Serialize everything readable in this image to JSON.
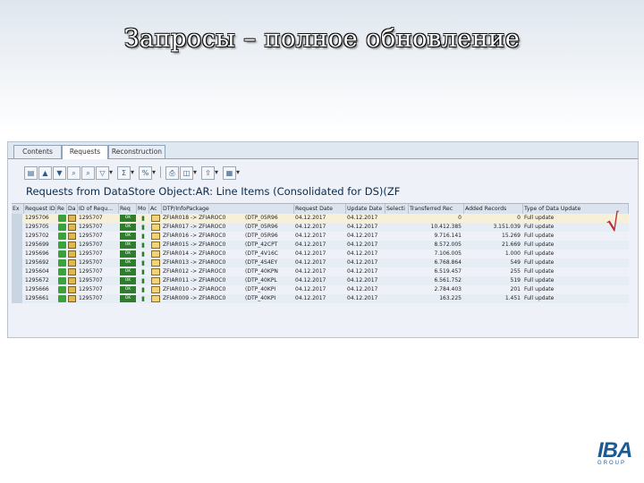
{
  "slide": {
    "title": "Запросы – полное обновление"
  },
  "tabs": [
    "Contents",
    "Requests",
    "Reconstruction"
  ],
  "grid": {
    "title": "Requests from DataStore Object:AR: Line Items (Consolidated for DS)(ZF",
    "columns": [
      "Request ID",
      "Re",
      "Da",
      "ID of Requ...",
      "Req",
      "Mo",
      "Ac",
      "DTP/InfoPackage",
      "Request Date",
      "Update Date",
      "Selecti",
      "Transferred Rec",
      "Added Records",
      "Type of Data Update"
    ],
    "rows": [
      {
        "request_id": "1295706",
        "id_of_request": "1295707",
        "dtp": "ZFIAR018 -> ZFIAROC0",
        "dtp_id": "(DTP_05R96",
        "request_date": "04.12.2017",
        "update_date": "04.12.2017",
        "transferred": "0",
        "added": "0",
        "type": "Full update"
      },
      {
        "request_id": "1295705",
        "id_of_request": "1295707",
        "dtp": "ZFIAR017 -> ZFIAROC0",
        "dtp_id": "(DTP_05R96",
        "request_date": "04.12.2017",
        "update_date": "04.12.2017",
        "transferred": "10.412.385",
        "added": "3.151.039",
        "type": "Full update"
      },
      {
        "request_id": "1295702",
        "id_of_request": "1295707",
        "dtp": "ZFIAR016 -> ZFIAROC0",
        "dtp_id": "(DTP_05R96",
        "request_date": "04.12.2017",
        "update_date": "04.12.2017",
        "transferred": "9.716.141",
        "added": "15.269",
        "type": "Full update"
      },
      {
        "request_id": "1295699",
        "id_of_request": "1295707",
        "dtp": "ZFIAR015 -> ZFIAROC0",
        "dtp_id": "(DTP_42CPT",
        "request_date": "04.12.2017",
        "update_date": "04.12.2017",
        "transferred": "8.572.005",
        "added": "21.669",
        "type": "Full update"
      },
      {
        "request_id": "1295696",
        "id_of_request": "1295707",
        "dtp": "ZFIAR014 -> ZFIAROC0",
        "dtp_id": "(DTP_4V16C",
        "request_date": "04.12.2017",
        "update_date": "04.12.2017",
        "transferred": "7.106.005",
        "added": "1.000",
        "type": "Full update"
      },
      {
        "request_id": "1295692",
        "id_of_request": "1295707",
        "dtp": "ZFIAR013 -> ZFIAROC0",
        "dtp_id": "(DTP_4S4EY",
        "request_date": "04.12.2017",
        "update_date": "04.12.2017",
        "transferred": "6.768.864",
        "added": "549",
        "type": "Full update"
      },
      {
        "request_id": "1295604",
        "id_of_request": "1295707",
        "dtp": "ZFIAR012 -> ZFIAROC0",
        "dtp_id": "(DTP_40KPN",
        "request_date": "04.12.2017",
        "update_date": "04.12.2017",
        "transferred": "6.519.457",
        "added": "255",
        "type": "Full update"
      },
      {
        "request_id": "1295672",
        "id_of_request": "1295707",
        "dtp": "ZFIAR011 -> ZFIAROC0",
        "dtp_id": "(DTP_40KPL",
        "request_date": "04.12.2017",
        "update_date": "04.12.2017",
        "transferred": "6.561.752",
        "added": "519",
        "type": "Full update"
      },
      {
        "request_id": "1295666",
        "id_of_request": "1295707",
        "dtp": "ZFIAR010 -> ZFIAROC0",
        "dtp_id": "(DTP_40KPI",
        "request_date": "04.12.2017",
        "update_date": "04.12.2017",
        "transferred": "2.784.403",
        "added": "201",
        "type": "Full update"
      },
      {
        "request_id": "1295661",
        "id_of_request": "1295707",
        "dtp": "ZFIAR009 -> ZFIAROC0",
        "dtp_id": "(DTP_40KPI",
        "request_date": "04.12.2017",
        "update_date": "04.12.2017",
        "transferred": "163.225",
        "added": "1.451",
        "type": "Full update"
      }
    ]
  },
  "logo": {
    "main": "IBA",
    "sub": "GROUP"
  },
  "icons": [
    "table-settings-icon",
    "sort-ascending-icon",
    "sort-descending-icon",
    "filter-icon",
    "sum-icon",
    "export-icon",
    "print-icon",
    "layout-icon",
    "details-icon"
  ]
}
